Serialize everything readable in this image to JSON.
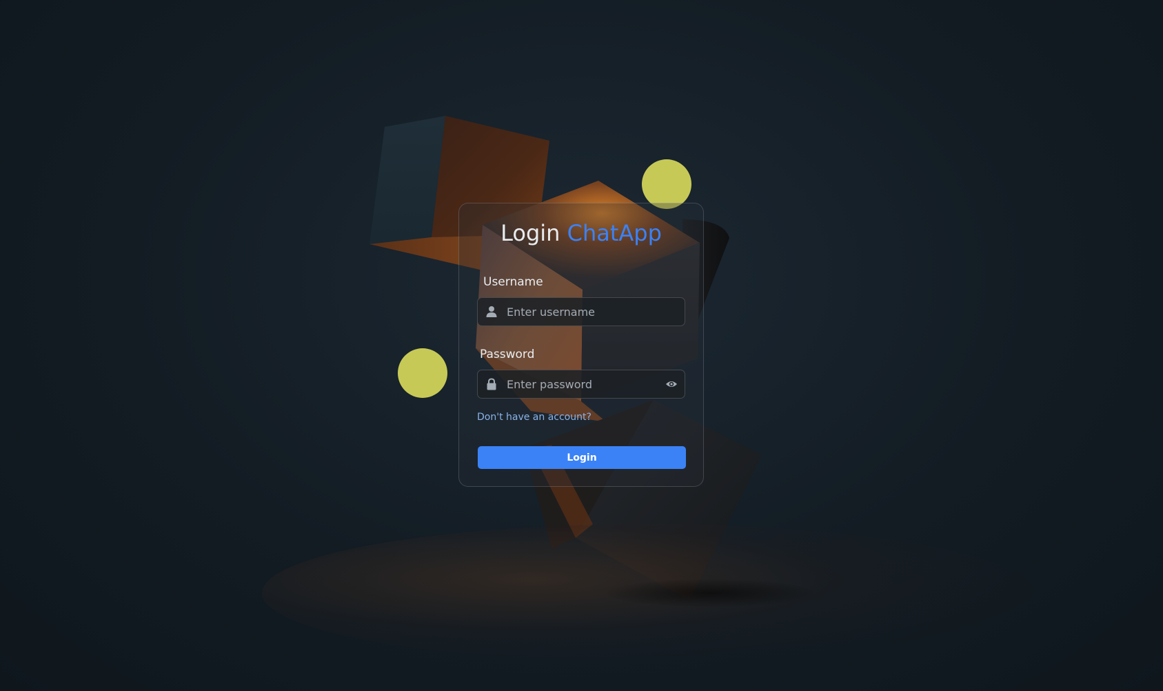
{
  "login_card": {
    "title_prefix": "Login",
    "title_brand": "ChatApp",
    "username_label": "Username",
    "username_placeholder": "Enter username",
    "username_value": "",
    "password_label": "Password",
    "password_placeholder": "Enter password",
    "password_value": "",
    "signup_link": "Don't have an account?",
    "login_button": "Login"
  },
  "icons": {
    "username": "user-icon",
    "password": "lock-icon",
    "visibility": "eye-icon"
  },
  "colors": {
    "accent": "#3b82f6",
    "link": "#89b4ea",
    "decor_circle": "#c7c957",
    "background": "#131c23"
  }
}
